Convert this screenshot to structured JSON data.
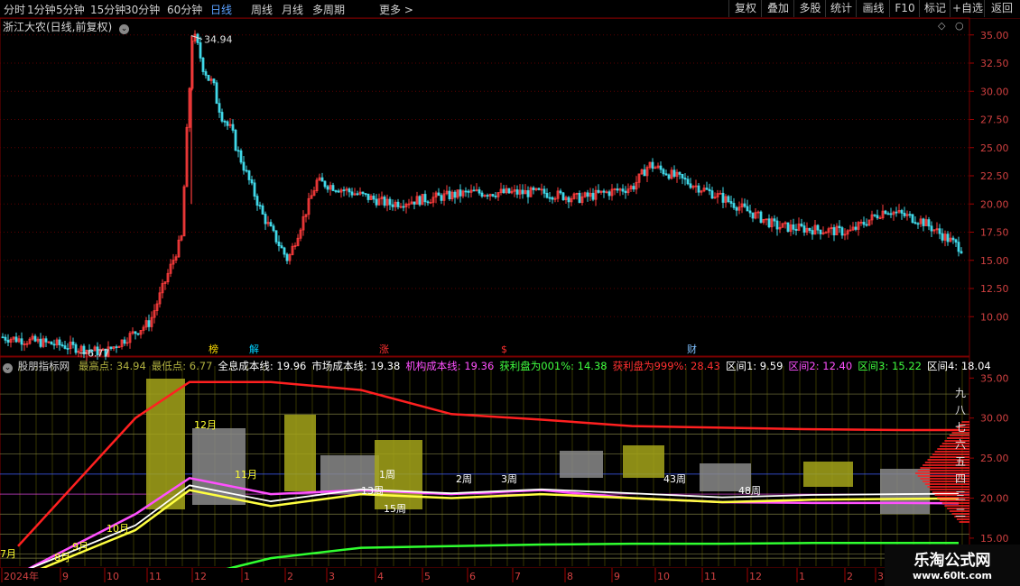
{
  "toolbar": {
    "left": [
      "分时",
      "1分钟",
      "5分钟",
      "15分钟",
      "30分钟",
      "60分钟",
      "日线",
      "周线",
      "月线",
      "多周期",
      "更多 >"
    ],
    "active_index": 6,
    "right": [
      "复权",
      "叠加",
      "多股",
      "统计",
      "画线",
      "F10",
      "标记",
      "+自选",
      "返回"
    ]
  },
  "stock_title": "浙江大农(日线,前复权)",
  "main_chart": {
    "y_ticks": [
      "35.00",
      "32.50",
      "30.00",
      "27.50",
      "25.00",
      "22.50",
      "20.00",
      "17.50",
      "15.00",
      "12.50",
      "10.00"
    ],
    "high_label": "34.94",
    "low_label": "6.77",
    "markers": [
      {
        "text": "榜",
        "color": "#ffdd00"
      },
      {
        "text": "解",
        "color": "#00d0ff"
      },
      {
        "text": "涨",
        "color": "#ff3030"
      },
      {
        "text": "$",
        "color": "#ff3030"
      },
      {
        "text": "财",
        "color": "#7fc0ff"
      }
    ]
  },
  "indicator": {
    "name": "股朋指标网",
    "stats": [
      {
        "text": "最高点: 34.94",
        "color": "#b0b040"
      },
      {
        "text": "最低点: 6.77",
        "color": "#b0b040"
      },
      {
        "text": "全息成本线: 19.96",
        "color": "#ffffff"
      },
      {
        "text": "市场成本线: 19.38",
        "color": "#ffffff"
      },
      {
        "text": "机构成本线: 19.36",
        "color": "#ff50ff"
      },
      {
        "text": "获利盘为001%: 14.38",
        "color": "#40ff40"
      },
      {
        "text": "获利盘为999%: 28.43",
        "color": "#ff3030"
      },
      {
        "text": "区间1: 9.59",
        "color": "#ffffff"
      },
      {
        "text": "区间2: 12.40",
        "color": "#ff50ff"
      },
      {
        "text": "区间3: 15.22",
        "color": "#40ff40"
      },
      {
        "text": "区间4: 18.04",
        "color": "#ffffff"
      }
    ],
    "y_ticks": [
      "35.00",
      "30.00",
      "25.00",
      "20.00",
      "15.00"
    ],
    "right_chars": [
      "九",
      "八",
      "七",
      "六",
      "五",
      "四",
      "三",
      "二"
    ],
    "period_labels": [
      "12月",
      "11月",
      "10月",
      "9月",
      "8月",
      "7月",
      "13周",
      "15周",
      "1周",
      "2周",
      "3周",
      "43周",
      "48周"
    ]
  },
  "x_axis": {
    "labels": [
      "2024年",
      "9",
      "10",
      "11",
      "12",
      "1",
      "2",
      "3",
      "4",
      "5",
      "6",
      "7",
      "8",
      "9",
      "10",
      "11",
      "12",
      "1",
      "2",
      "3"
    ]
  },
  "watermark": {
    "title": "乐淘公式网",
    "url": "www.60lt.com"
  },
  "chart_data": [
    {
      "type": "line",
      "title": "浙江大农(日线,前复权)",
      "ylim": [
        6,
        36
      ],
      "x": [
        "2024-08",
        "2024-09",
        "2024-10",
        "2024-11",
        "2024-12-mid",
        "2024-12",
        "2025-01",
        "2025-02",
        "2025-03",
        "2025-04",
        "2025-05",
        "2025-06",
        "2025-07",
        "2025-08",
        "2025-09",
        "2025-10",
        "2025-11",
        "2025-12",
        "2026-01",
        "2026-02",
        "2026-03"
      ],
      "series": [
        {
          "values": [
            8.2,
            7.5,
            6.8,
            9.5,
            17.0,
            34.94,
            19.0,
            15.0,
            22.0,
            20.0,
            21.0,
            21.0,
            20.5,
            21.5,
            23.5,
            20.5,
            18.0,
            17.5,
            19.5,
            18.5,
            16.0
          ]
        }
      ],
      "annotations": [
        "34.94",
        "6.77"
      ]
    },
    {
      "type": "line",
      "ylim": [
        11,
        36
      ],
      "series": [
        {
          "name": "获利盘为999%",
          "values": [
            14.0,
            30.0,
            34.5,
            34.5,
            33.5,
            30.5,
            29.8,
            29.0,
            28.8,
            28.6,
            28.5,
            28.5
          ]
        },
        {
          "name": "获利盘为001%",
          "values": [
            6.5,
            8.0,
            10.0,
            12.5,
            13.8,
            14.0,
            14.2,
            14.3,
            14.3,
            14.4,
            14.4,
            14.4
          ]
        },
        {
          "name": "全息成本线",
          "values": [
            10.0,
            16.0,
            21.0,
            19.0,
            20.5,
            20.0,
            20.5,
            20.0,
            19.5,
            19.8,
            19.9,
            19.96
          ]
        },
        {
          "name": "机构成本线",
          "values": [
            10.5,
            18.0,
            22.5,
            20.5,
            21.0,
            20.5,
            21.0,
            20.0,
            19.5,
            19.4,
            19.4,
            19.36
          ]
        }
      ]
    }
  ]
}
